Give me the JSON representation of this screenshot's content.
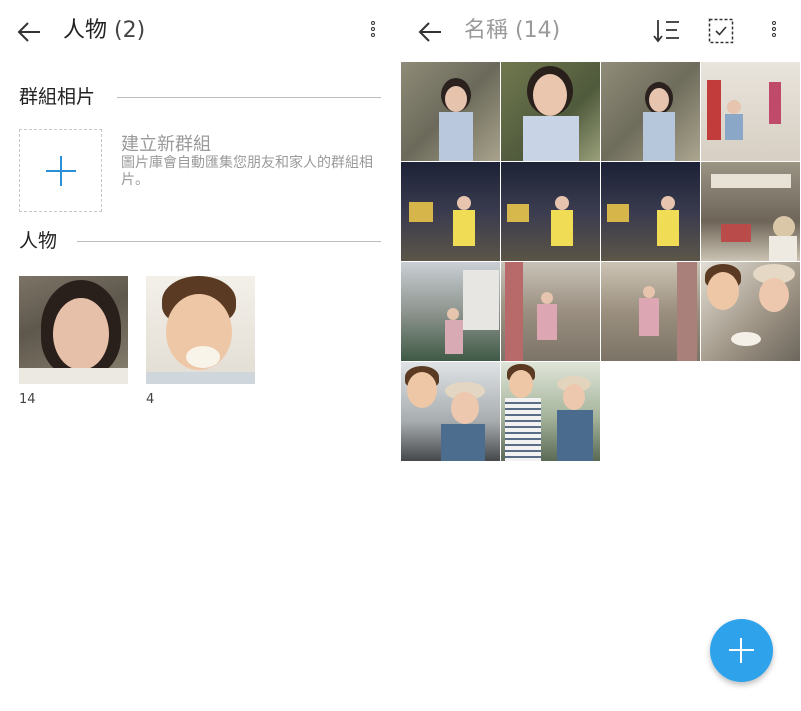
{
  "left": {
    "header": {
      "title": "人物",
      "count": "(2)"
    },
    "groups": {
      "section_label": "群組相片",
      "create_title": "建立新群組",
      "create_desc": "圖片庫會自動匯集您朋友和家人的群組相片。"
    },
    "people": {
      "section_label": "人物",
      "items": [
        {
          "count": "14"
        },
        {
          "count": "4"
        }
      ]
    }
  },
  "right": {
    "header": {
      "title": "名稱",
      "count": "(14)"
    },
    "photo_count": 14
  },
  "colors": {
    "accent": "#2ea3ec",
    "plus": "#2b8fd6"
  }
}
